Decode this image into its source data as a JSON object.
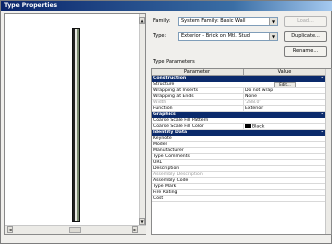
{
  "window": {
    "title": "Type Properties"
  },
  "preview": {
    "vscroll_up": "▲",
    "vscroll_down": "▼",
    "hscroll_left": "◄",
    "hscroll_right": "►"
  },
  "family": {
    "label": "Family:",
    "value": "System Family: Basic Wall"
  },
  "type": {
    "label": "Type:",
    "value": "Exterior - Brick on Mtl. Stud"
  },
  "buttons": {
    "load": "Load...",
    "duplicate": "Duplicate...",
    "rename": "Rename..."
  },
  "params": {
    "title": "Type Parameters",
    "col_parameter": "Parameter",
    "col_value": "Value",
    "edit_label": "Edit...",
    "groups": [
      {
        "name": "Construction",
        "toggle": "⌃",
        "rows": [
          {
            "p": "Structure",
            "v": ""
          },
          {
            "p": "Wrapping at Inserts",
            "v": "Do not wrap"
          },
          {
            "p": "Wrapping at Ends",
            "v": "None"
          },
          {
            "p": "Width",
            "v": "'288.0'"
          },
          {
            "p": "Function",
            "v": "Exterior"
          }
        ]
      },
      {
        "name": "Graphics",
        "toggle": "⌃",
        "rows": [
          {
            "p": "Coarse Scale Fill Pattern",
            "v": ""
          },
          {
            "p": "Coarse Scale Fill Color",
            "v": "Black"
          }
        ]
      },
      {
        "name": "Identity Data",
        "toggle": "⌃",
        "rows": [
          {
            "p": "Keynote",
            "v": ""
          },
          {
            "p": "Model",
            "v": ""
          },
          {
            "p": "Manufacturer",
            "v": ""
          },
          {
            "p": "Type Comments",
            "v": ""
          },
          {
            "p": "URL",
            "v": ""
          },
          {
            "p": "Description",
            "v": ""
          },
          {
            "p": "Assembly Description",
            "v": ""
          },
          {
            "p": "Assembly Code",
            "v": ""
          },
          {
            "p": "Type Mark",
            "v": ""
          },
          {
            "p": "Fire Rating",
            "v": ""
          },
          {
            "p": "Cost",
            "v": ""
          }
        ]
      }
    ]
  }
}
